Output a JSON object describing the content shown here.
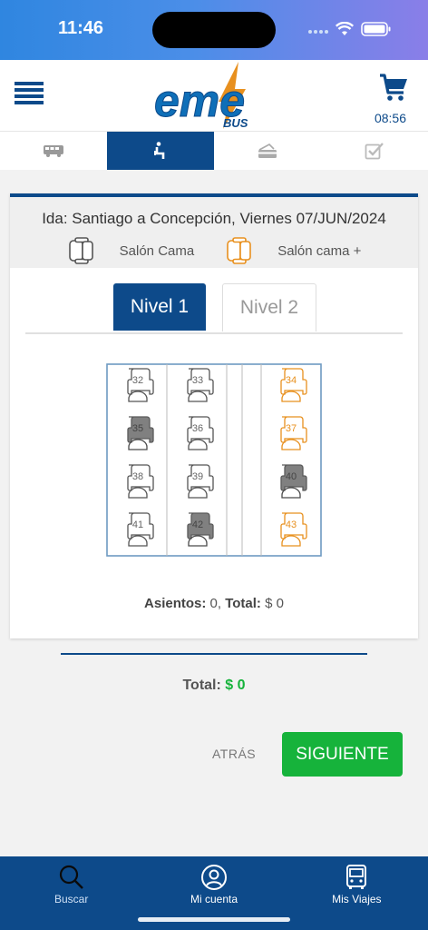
{
  "status": {
    "time": "11:46"
  },
  "header": {
    "logo_text": "eme",
    "logo_sub": "BUS",
    "timer": "08:56"
  },
  "trip": {
    "title": "Ida: Santiago a Concepción, Viernes 07/JUN/2024",
    "legend": [
      {
        "label": "Salón Cama",
        "color": "#555555"
      },
      {
        "label": "Salón cama +",
        "color": "#e8901e"
      }
    ]
  },
  "tabs": [
    "Nivel 1",
    "Nivel 2"
  ],
  "seats": [
    {
      "num": "32",
      "type": "cama",
      "status": "free"
    },
    {
      "num": "33",
      "type": "cama",
      "status": "free"
    },
    {
      "num": "34",
      "type": "cama_plus",
      "status": "free"
    },
    {
      "num": "35",
      "type": "cama",
      "status": "occupied"
    },
    {
      "num": "36",
      "type": "cama",
      "status": "free"
    },
    {
      "num": "37",
      "type": "cama_plus",
      "status": "free"
    },
    {
      "num": "38",
      "type": "cama",
      "status": "free"
    },
    {
      "num": "39",
      "type": "cama",
      "status": "free"
    },
    {
      "num": "40",
      "type": "cama_plus",
      "status": "occupied"
    },
    {
      "num": "41",
      "type": "cama",
      "status": "free"
    },
    {
      "num": "42",
      "type": "cama",
      "status": "occupied"
    },
    {
      "num": "43",
      "type": "cama_plus",
      "status": "free"
    }
  ],
  "summary": {
    "seats_label": "Asientos:",
    "seats_value": "0",
    "total_label": "Total:",
    "total_value": "$ 0"
  },
  "total": {
    "label": "Total:",
    "value": "$ 0"
  },
  "buttons": {
    "back": "ATRÁS",
    "next": "SIGUIENTE"
  },
  "nav": [
    {
      "label": "Buscar",
      "icon": "search-icon"
    },
    {
      "label": "Mi cuenta",
      "icon": "user-icon"
    },
    {
      "label": "Mis Viajes",
      "icon": "bus-icon"
    }
  ],
  "colors": {
    "primary": "#0d4a8a",
    "success": "#16b33b",
    "accent": "#e8901e"
  }
}
